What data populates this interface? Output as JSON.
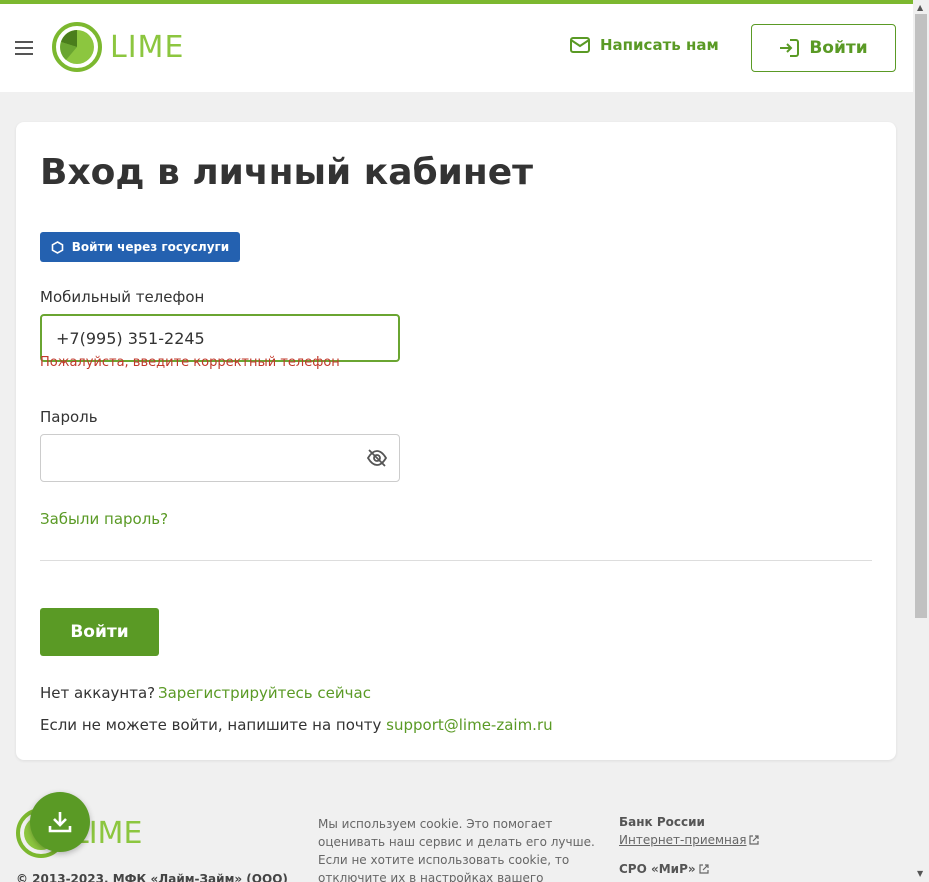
{
  "header": {
    "logo_text": "LIME",
    "write_us": "Написать нам",
    "login": "Войти"
  },
  "form": {
    "title": "Вход в личный кабинет",
    "gosuslugi": "Войти через госуслуги",
    "phone_label": "Мобильный телефон",
    "phone_value": "+7(995) 351-2245",
    "phone_error": "Пожалуйста, введите корректный телефон",
    "password_label": "Пароль",
    "password_value": "",
    "forgot": "Забыли пароль?",
    "submit": "Войти",
    "no_account": "Нет аккаунта?",
    "register": "Зарегистрируйтесь сейчас",
    "support_text": "Если не можете войти, напишите на почту ",
    "support_email": "support@lime-zaim.ru"
  },
  "footer": {
    "logo_text": "LIME",
    "copyright": "© 2013-2023. МФК «Лайм-Займ» (ООО)",
    "cookie": "Мы используем cookie. Это помогает оценивать наш сервис и делать его лучше. Если не хотите использовать cookie, то отключите их в настройках вашего браузера. В этом случае",
    "bank": "Банк России",
    "reception": "Интернет-приемная",
    "sro": "СРО «МиР»"
  },
  "colors": {
    "accent": "#5a9a25",
    "logo": "#8cc63f",
    "gosuslugi": "#2461b0",
    "error": "#c0392b"
  }
}
